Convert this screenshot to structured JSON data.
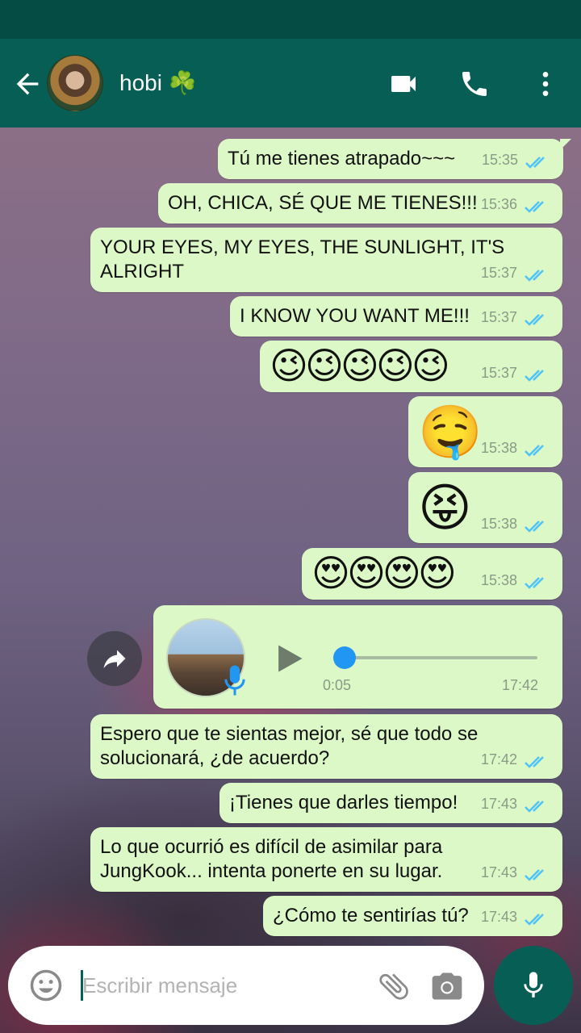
{
  "header": {
    "contact_name": "hobi ☘️",
    "icons": [
      "back-arrow-icon",
      "video-call-icon",
      "phone-icon",
      "more-vert-icon"
    ]
  },
  "messages": [
    {
      "text": "Tú me tienes atrapado~~~",
      "time": "15:35"
    },
    {
      "text": "OH, CHICA, SÉ QUE ME TIENES!!!",
      "time": "15:36"
    },
    {
      "text": "YOUR EYES, MY EYES, THE SUNLIGHT, IT'S\nALRIGHT",
      "time": "15:37"
    },
    {
      "text": "I KNOW YOU WANT ME!!!",
      "time": "15:37"
    },
    {
      "text": "😉😉😉😉😉",
      "time": "15:37"
    },
    {
      "text": "🤤",
      "time": "15:38"
    },
    {
      "text": "😝",
      "time": "15:38"
    },
    {
      "text": "😍😍😍😍",
      "time": "15:38"
    },
    {
      "text": "Espero que te sientas mejor, sé que todo se\nsolucionará, ¿de acuerdo?",
      "time": "17:42"
    },
    {
      "text": "¡Tienes que darles tiempo!",
      "time": "17:43"
    },
    {
      "text": "Lo que ocurrió es difícil de asimilar para\nJungKook... intenta ponerte en su lugar.",
      "time": "17:43"
    },
    {
      "text": "¿Cómo te sentirías tú?",
      "time": "17:43"
    }
  ],
  "voice_note": {
    "elapsed": "0:05",
    "time": "17:42",
    "progress": 0.05
  },
  "input": {
    "placeholder": "Escribir mensaje"
  },
  "colors": {
    "header": "#075e54",
    "statusbar": "#054d44",
    "bubble": "#dcf8c6",
    "tick_read": "#4fc3f7",
    "accent": "#075e54"
  }
}
